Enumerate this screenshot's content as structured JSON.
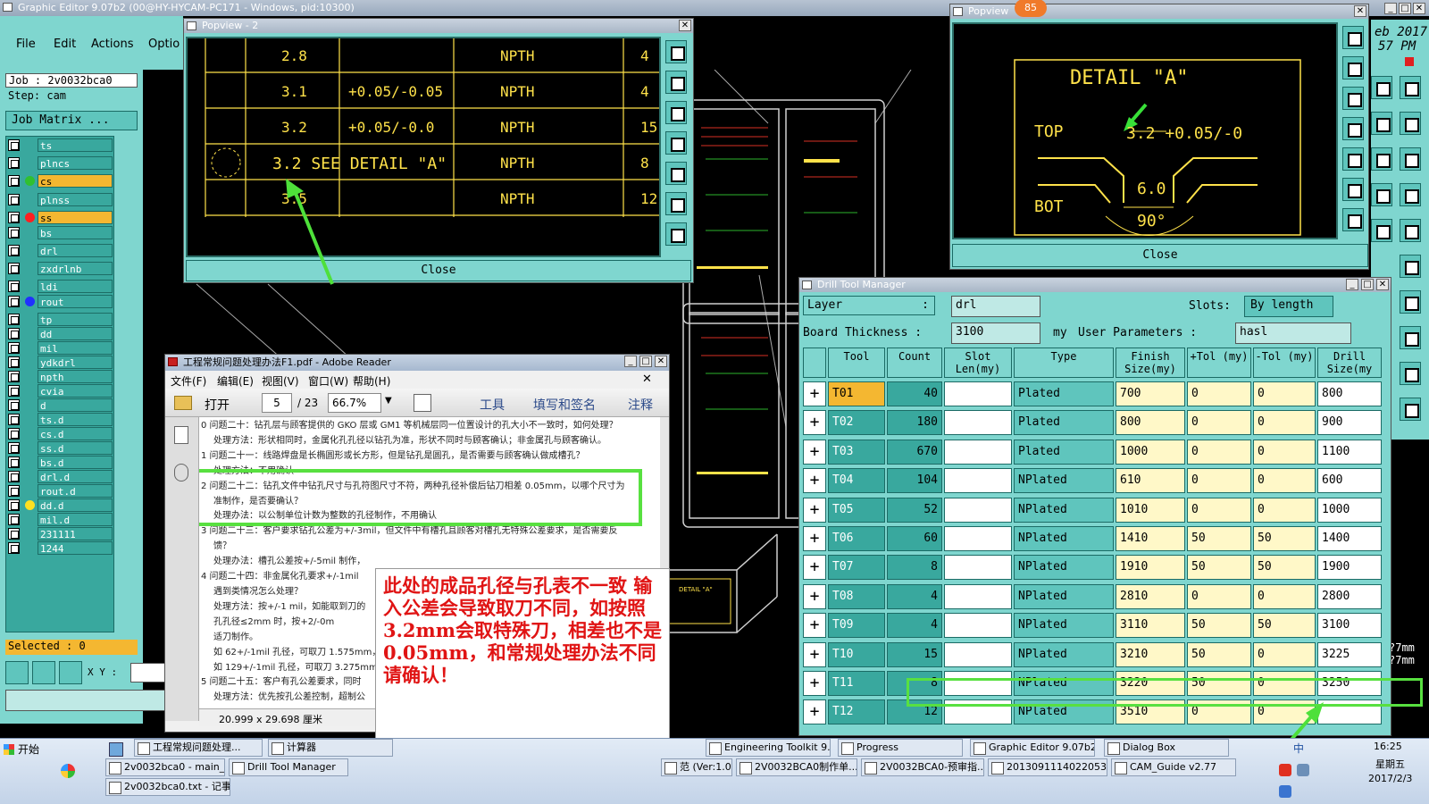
{
  "main_window": {
    "title": "Graphic Editor 9.07b2 (00@HY-HYCAM-PC171 - Windows, pid:10300)",
    "menu": [
      "File",
      "Edit",
      "Actions",
      "Optio"
    ],
    "job_label": "Job : 2v0032bca0",
    "step_label": "Step: cam",
    "job_matrix": "Job Matrix ...",
    "selected": "Selected : 0",
    "xy_label": "X Y :",
    "layers": [
      {
        "name": "ts",
        "color": "#39a89e",
        "dot": ""
      },
      {
        "name": "plncs",
        "color": "#39a89e",
        "dot": ""
      },
      {
        "name": "cs",
        "color": "#f4b731",
        "dot": "#30c030"
      },
      {
        "name": "plnss",
        "color": "#39a89e",
        "dot": ""
      },
      {
        "name": "ss",
        "color": "#f4b731",
        "dot": "#ff2020"
      },
      {
        "name": "bs",
        "color": "#39a89e",
        "dot": ""
      },
      {
        "name": "drl",
        "color": "#39a89e",
        "dot": ""
      },
      {
        "name": "zxdrlnb",
        "color": "#39a89e",
        "dot": ""
      },
      {
        "name": "ldi",
        "color": "#39a89e",
        "dot": ""
      },
      {
        "name": "rout",
        "color": "#39a89e",
        "dot": "#2030ff"
      },
      {
        "name": "tp",
        "color": "#39a89e",
        "dot": ""
      },
      {
        "name": "dd",
        "color": "#39a89e",
        "dot": ""
      },
      {
        "name": "mil",
        "color": "#39a89e",
        "dot": ""
      },
      {
        "name": "ydkdrl",
        "color": "#39a89e",
        "dot": ""
      },
      {
        "name": "npth",
        "color": "#39a89e",
        "dot": ""
      },
      {
        "name": "cvia",
        "color": "#39a89e",
        "dot": ""
      },
      {
        "name": "d",
        "color": "#39a89e",
        "dot": ""
      },
      {
        "name": "ts.d",
        "color": "#39a89e",
        "dot": ""
      },
      {
        "name": "cs.d",
        "color": "#39a89e",
        "dot": ""
      },
      {
        "name": "ss.d",
        "color": "#39a89e",
        "dot": ""
      },
      {
        "name": "bs.d",
        "color": "#39a89e",
        "dot": ""
      },
      {
        "name": "drl.d",
        "color": "#39a89e",
        "dot": ""
      },
      {
        "name": "rout.d",
        "color": "#39a89e",
        "dot": ""
      },
      {
        "name": "dd.d",
        "color": "#39a89e",
        "dot": "#ffe020"
      },
      {
        "name": "mil.d",
        "color": "#39a89e",
        "dot": ""
      },
      {
        "name": "231111",
        "color": "#39a89e",
        "dot": ""
      },
      {
        "name": "1244",
        "color": "#39a89e",
        "dot": ""
      }
    ],
    "top_right_date_1": "eb 2017",
    "top_right_date_2": "57 PM",
    "mm_1": "?7mm",
    "mm_2": "?7mm"
  },
  "popview2": {
    "title": "Popview - 2",
    "rows": [
      {
        "size": "2.8",
        "tol": "",
        "type": "NPTH",
        "count": "4"
      },
      {
        "size": "3.1",
        "tol": "+0.05/-0.05",
        "type": "NPTH",
        "count": "4"
      },
      {
        "size": "3.2",
        "tol": "+0.05/-0.0",
        "type": "NPTH",
        "count": "15"
      },
      {
        "size": "3.2  SEE DETAIL \"A\"",
        "tol": "",
        "type": "NPTH",
        "count": "8"
      },
      {
        "size": "3.5",
        "tol": "",
        "type": "NPTH",
        "count": "12"
      }
    ],
    "close": "Close"
  },
  "popview_right": {
    "title": "Popview",
    "badge": "85",
    "detail_title": "DETAIL \"A\"",
    "top": "TOP",
    "bot": "BOT",
    "dim": "3.2 +0.05/-0",
    "width": "6.0",
    "angle": "90°",
    "close": "Close"
  },
  "drill_tool_manager": {
    "title": "Drill Tool Manager",
    "layer_label": "Layer",
    "layer_value": "drl",
    "slots_label": "Slots:",
    "slots_value": "By length",
    "board_thickness_label": "Board Thickness :",
    "board_thickness_value": "3100",
    "unit": "my",
    "user_params_label": "User Parameters :",
    "user_params_value": "hasl",
    "headers": [
      "Tool",
      "Count",
      "Slot Len(my)",
      "Type",
      "Finish Size(my)",
      "+Tol (my)",
      "-Tol (my)",
      "Drill Size(my"
    ],
    "rows": [
      {
        "tool": "T01",
        "count": "40",
        "type": "Plated",
        "finish": "700",
        "ptol": "0",
        "mtol": "0",
        "drill": "800"
      },
      {
        "tool": "T02",
        "count": "180",
        "type": "Plated",
        "finish": "800",
        "ptol": "0",
        "mtol": "0",
        "drill": "900"
      },
      {
        "tool": "T03",
        "count": "670",
        "type": "Plated",
        "finish": "1000",
        "ptol": "0",
        "mtol": "0",
        "drill": "1100"
      },
      {
        "tool": "T04",
        "count": "104",
        "type": "NPlated",
        "finish": "610",
        "ptol": "0",
        "mtol": "0",
        "drill": "600"
      },
      {
        "tool": "T05",
        "count": "52",
        "type": "NPlated",
        "finish": "1010",
        "ptol": "0",
        "mtol": "0",
        "drill": "1000"
      },
      {
        "tool": "T06",
        "count": "60",
        "type": "NPlated",
        "finish": "1410",
        "ptol": "50",
        "mtol": "50",
        "drill": "1400"
      },
      {
        "tool": "T07",
        "count": "8",
        "type": "NPlated",
        "finish": "1910",
        "ptol": "50",
        "mtol": "50",
        "drill": "1900"
      },
      {
        "tool": "T08",
        "count": "4",
        "type": "NPlated",
        "finish": "2810",
        "ptol": "0",
        "mtol": "0",
        "drill": "2800"
      },
      {
        "tool": "T09",
        "count": "4",
        "type": "NPlated",
        "finish": "3110",
        "ptol": "50",
        "mtol": "50",
        "drill": "3100"
      },
      {
        "tool": "T10",
        "count": "15",
        "type": "NPlated",
        "finish": "3210",
        "ptol": "50",
        "mtol": "0",
        "drill": "3225"
      },
      {
        "tool": "T11",
        "count": "8",
        "type": "NPlated",
        "finish": "3220",
        "ptol": "50",
        "mtol": "0",
        "drill": "3250"
      },
      {
        "tool": "T12",
        "count": "12",
        "type": "NPlated",
        "finish": "3510",
        "ptol": "0",
        "mtol": "0",
        "drill": ""
      }
    ]
  },
  "adobe_reader": {
    "title": "工程常规问题处理办法F1.pdf - Adobe Reader",
    "menu": [
      "文件(F)",
      "编辑(E)",
      "视图(V)",
      "窗口(W)",
      "帮助(H)"
    ],
    "open": "打开",
    "page": "5",
    "page_total": "/ 23",
    "zoom": "66.7%",
    "tools": "工具",
    "sign": "填写和签名",
    "comment": "注释",
    "page_size": "20.999 x 29.698 厘米",
    "lines": [
      "0  问题二十：钻孔层与顾客提供的 GKO 层或 GM1 等机械层同一位置设计的孔大小不一致时，如何处理？",
      "处理方法：形状相同时，金属化孔孔径以钻孔为准，形状不同时与顾客确认；非金属孔与顾客确认。",
      "1  问题二十一：线路焊盘是长椭圆形或长方形，但是钻孔是圆孔，是否需要与顾客确认做成槽孔？",
      "处理方法：不用确认",
      "2  问题二十二：钻孔文件中钻孔尺寸与孔符图尺寸不符，两种孔径补偿后钻刀相差 0.05mm，以哪个尺寸为",
      "准制作，是否要确认？",
      "处理办法：以公制单位计数为整数的孔径制作，不用确认",
      "3  问题二十三：客户要求钻孔公差为+/-3mil，但文件中有槽孔且顾客对槽孔无特殊公差要求，是否需要反",
      "馈？",
      "处理办法：槽孔公差按+/-5mil 制作，",
      "4  问题二十四：非金属化孔要求+/-1mil",
      "遇到类情况怎么处理？",
      "处理方法：按+/-1 mil，如能取到刀的",
      "孔孔径≤2mm 时，按+2/-0m",
      "适刀制作。",
      "如 62+/-1mil 孔径，可取刀 1.575mm，",
      "如 129+/-1mil 孔径，可取刀 3.275mm，",
      "5  问题二十五：客户有孔公差要求，同时",
      "处理方法：优先按孔公差控制，超制公"
    ]
  },
  "annotation": {
    "text": "此处的成品孔径与孔表不一致  输入公差会导致取刀不同，如按照3.2mm会取特殊刀，相差也不是0.05mm，和常规处理办法不同  请确认！"
  },
  "taskbar": {
    "start": "开始",
    "row1": [
      "工程常规问题处理...",
      "计算器",
      "Engineering Toolkit 9.0...",
      "Progress",
      "Graphic Editor 9.07b2 (...",
      "Dialog Box"
    ],
    "row2": [
      "2v0032bca0 - main_qa",
      "Drill Tool Manager",
      "范 (Ver:1.0.6)",
      "2V0032BCA0制作单....",
      "2V0032BCA0-预审指...",
      "20130911140220531...",
      "CAM_Guide v2.77"
    ],
    "row3": [
      "2v0032bca0.txt - 记事本"
    ],
    "ime": "中",
    "time": "16:25",
    "weekday": "星期五",
    "date": "2017/2/3"
  }
}
